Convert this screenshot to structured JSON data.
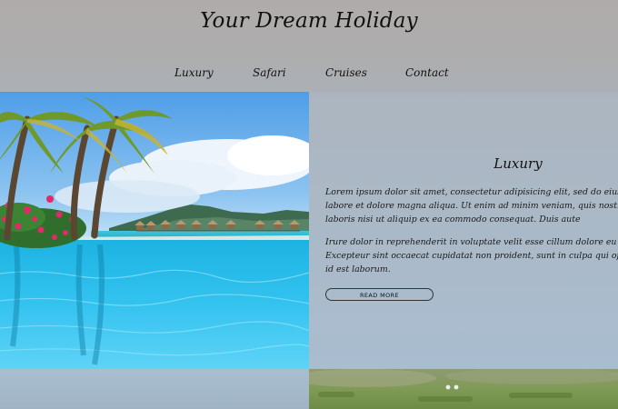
{
  "header": {
    "title": "Your Dream Holiday"
  },
  "nav": {
    "items": [
      "Luxury",
      "Safari",
      "Cruises",
      "Contact"
    ]
  },
  "hero": {
    "image_name": "tropical-resort-pool-photo"
  },
  "content": {
    "title": "Luxury",
    "paragraph1": [
      "Lorem ipsum dolor sit amet, consectetur adipisicing elit, sed do eiusmod ter",
      "labore et dolore magna aliqua. Ut enim ad minim veniam, quis nostrud exerci",
      "laboris nisi ut aliquip ex ea commodo consequat. Duis aute"
    ],
    "paragraph2": [
      "Irure dolor in reprehenderit in voluptate velit esse cillum dolore eu fugiat nu",
      "Excepteur sint occaecat cupidatat non proident, sunt in culpa qui officia de",
      "id est laborum."
    ],
    "button_label": "READ MORE"
  },
  "bottom": {
    "image_name": "grass-field-photo"
  }
}
